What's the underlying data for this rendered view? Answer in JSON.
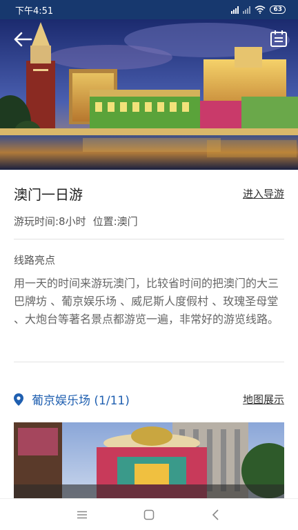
{
  "status_bar": {
    "time": "下午4:51",
    "battery": "63"
  },
  "header": {
    "back_icon": "back-arrow-icon",
    "menu_icon": "list-menu-icon"
  },
  "route": {
    "title": "澳门一日游",
    "guide_link": "进入导游",
    "duration": "游玩时间:8小时",
    "location": "位置:澳门",
    "highlights_label": "线路亮点",
    "description": "用一天的时间来游玩澳门，比较省时间的把澳门的大三巴牌坊 、葡京娱乐场 、威尼斯人度假村 、玫瑰圣母堂 、大炮台等著名景点都游览一遍，非常好的游览线路。"
  },
  "current_spot": {
    "name": "葡京娱乐场 (1/11)",
    "map_link": "地图展示",
    "pin_icon": "location-pin-icon"
  },
  "colors": {
    "accent": "#1f5fb0",
    "status_bar": "#17386e"
  },
  "nav_bar": {
    "icons": [
      "menu-icon",
      "home-square-icon",
      "back-chevron-icon"
    ]
  }
}
